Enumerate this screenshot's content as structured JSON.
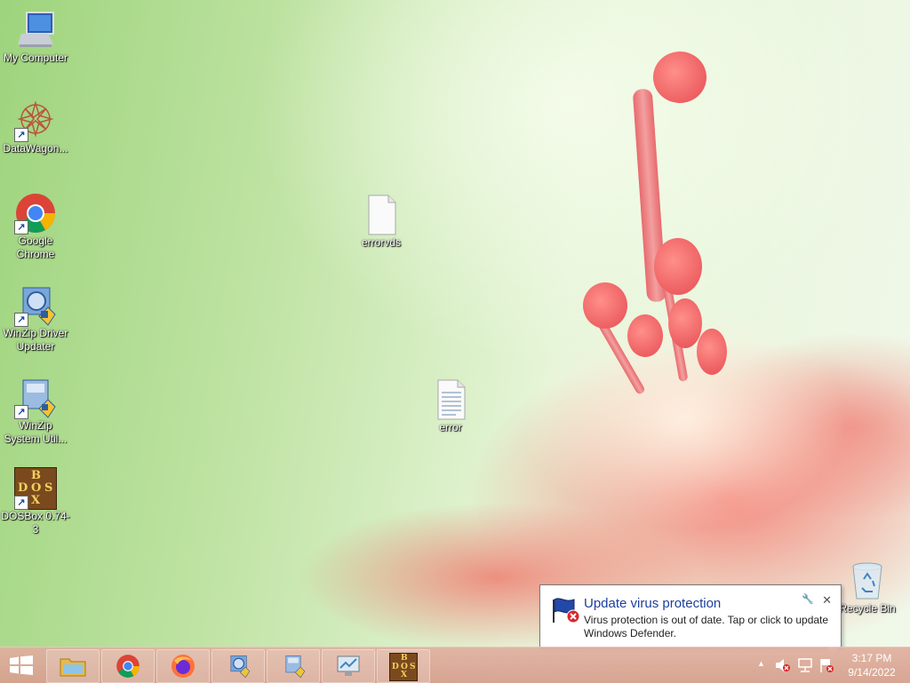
{
  "desktop": {
    "icons": [
      {
        "label": "My Computer",
        "icon": "computer-icon"
      },
      {
        "label": "DataWagon...",
        "icon": "datawagon-icon"
      },
      {
        "label": "Google Chrome",
        "icon": "chrome-icon"
      },
      {
        "label": "WinZip Driver Updater",
        "icon": "winzip-driver-icon"
      },
      {
        "label": "WinZip System Util...",
        "icon": "winzip-system-icon"
      },
      {
        "label": "DOSBox 0.74-3",
        "icon": "dosbox-icon"
      }
    ],
    "files": [
      {
        "label": "errorvds",
        "icon": "blank-file-icon"
      },
      {
        "label": "error",
        "icon": "text-file-icon"
      }
    ],
    "recycle_bin": {
      "label": "Recycle Bin",
      "icon": "recycle-bin-icon"
    },
    "dosbox_glyph": {
      "b": "B",
      "o": "O",
      "d": "D",
      "s": "S",
      "x": "X"
    }
  },
  "notification": {
    "title": "Update virus protection",
    "body": "Virus protection is out of date. Tap or click to update Windows Defender.",
    "close_label": "✕",
    "pin_label": "🔧"
  },
  "taskbar": {
    "pinned": [
      "file-explorer-icon",
      "chrome-icon",
      "firefox-icon",
      "winzip-driver-icon",
      "winzip-system-icon",
      "monitor-icon",
      "dosbox-icon"
    ],
    "tray": {
      "overflow_label": "▲",
      "time": "3:17 PM",
      "date": "9/14/2022"
    }
  },
  "colors": {
    "notification_title": "#1d3f9c",
    "taskbar": "#d8a493"
  }
}
